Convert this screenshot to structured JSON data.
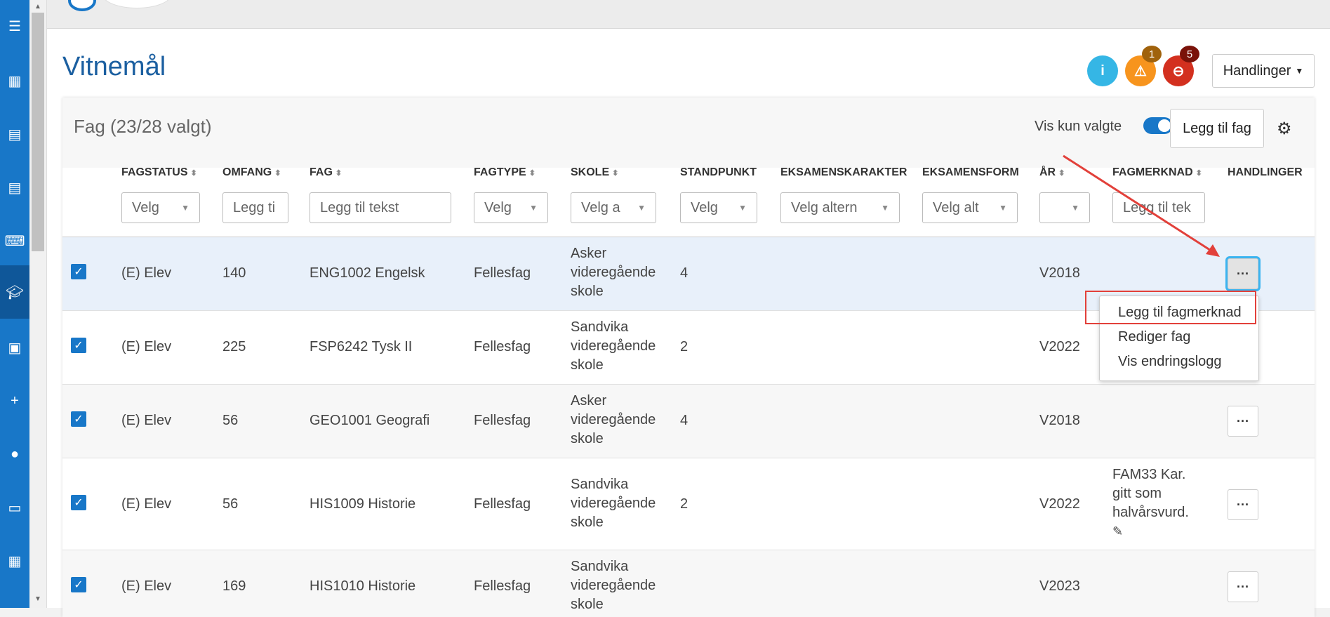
{
  "page": {
    "title": "Vitnemål"
  },
  "status": {
    "info_badge": "",
    "warning_count": "1",
    "error_count": "5"
  },
  "header": {
    "handlinger_label": "Handlinger"
  },
  "card": {
    "title": "Fag (23/28 valgt)",
    "toggle_label": "Vis kun valgte",
    "add_button": "Legg til fag"
  },
  "columns": [
    {
      "label": "FAGSTATUS",
      "filter": "Velg"
    },
    {
      "label": "OMFANG",
      "filter": "Legg ti"
    },
    {
      "label": "FAG",
      "filter": "Legg til tekst"
    },
    {
      "label": "FAGTYPE",
      "filter": "Velg"
    },
    {
      "label": "SKOLE",
      "filter": "Velg a"
    },
    {
      "label": "STANDPUNKT",
      "filter": "Velg"
    },
    {
      "label": "EKSAMENSKARAKTER",
      "filter": "Velg altern"
    },
    {
      "label": "EKSAMENSFORM",
      "filter": "Velg alt"
    },
    {
      "label": "ÅR",
      "filter": ""
    },
    {
      "label": "FAGMERKNAD",
      "filter": "Legg til tek"
    },
    {
      "label": "HANDLINGER",
      "filter": ""
    }
  ],
  "rows": [
    {
      "status": "(E) Elev",
      "omfang": "140",
      "fag": "ENG1002 Engelsk",
      "fagtype": "Fellesfag",
      "skole1": "Asker",
      "skole2": "videregående",
      "skole3": "skole",
      "standpunkt": "4",
      "ar": "V2018",
      "merknad1": "",
      "merknad2": "",
      "merknad3": ""
    },
    {
      "status": "(E) Elev",
      "omfang": "225",
      "fag": "FSP6242 Tysk II",
      "fagtype": "Fellesfag",
      "skole1": "Sandvika",
      "skole2": "videregående",
      "skole3": "skole",
      "standpunkt": "2",
      "ar": "V2022",
      "merknad1": "",
      "merknad2": "",
      "merknad3": ""
    },
    {
      "status": "(E) Elev",
      "omfang": "56",
      "fag": "GEO1001 Geografi",
      "fagtype": "Fellesfag",
      "skole1": "Asker",
      "skole2": "videregående",
      "skole3": "skole",
      "standpunkt": "4",
      "ar": "V2018",
      "merknad1": "",
      "merknad2": "",
      "merknad3": ""
    },
    {
      "status": "(E) Elev",
      "omfang": "56",
      "fag": "HIS1009 Historie",
      "fagtype": "Fellesfag",
      "skole1": "Sandvika",
      "skole2": "videregående",
      "skole3": "skole",
      "standpunkt": "2",
      "ar": "V2022",
      "merknad1": "FAM33 Kar.",
      "merknad2": "gitt som",
      "merknad3": "halvårsvurd."
    },
    {
      "status": "(E) Elev",
      "omfang": "169",
      "fag": "HIS1010 Historie",
      "fagtype": "Fellesfag",
      "skole1": "Sandvika",
      "skole2": "videregående",
      "skole3": "skole",
      "standpunkt": "",
      "ar": "V2023",
      "merknad1": "",
      "merknad2": "",
      "merknad3": ""
    }
  ],
  "menu": {
    "items": [
      "Legg til fagmerknad",
      "Rediger fag",
      "Vis endringslogg"
    ]
  },
  "colors": {
    "brand": "#1877c8",
    "title": "#1b5fa0",
    "info": "#35b6e5",
    "warning": "#f7941d",
    "error": "#d3301f",
    "highlight": "#e2403a"
  }
}
